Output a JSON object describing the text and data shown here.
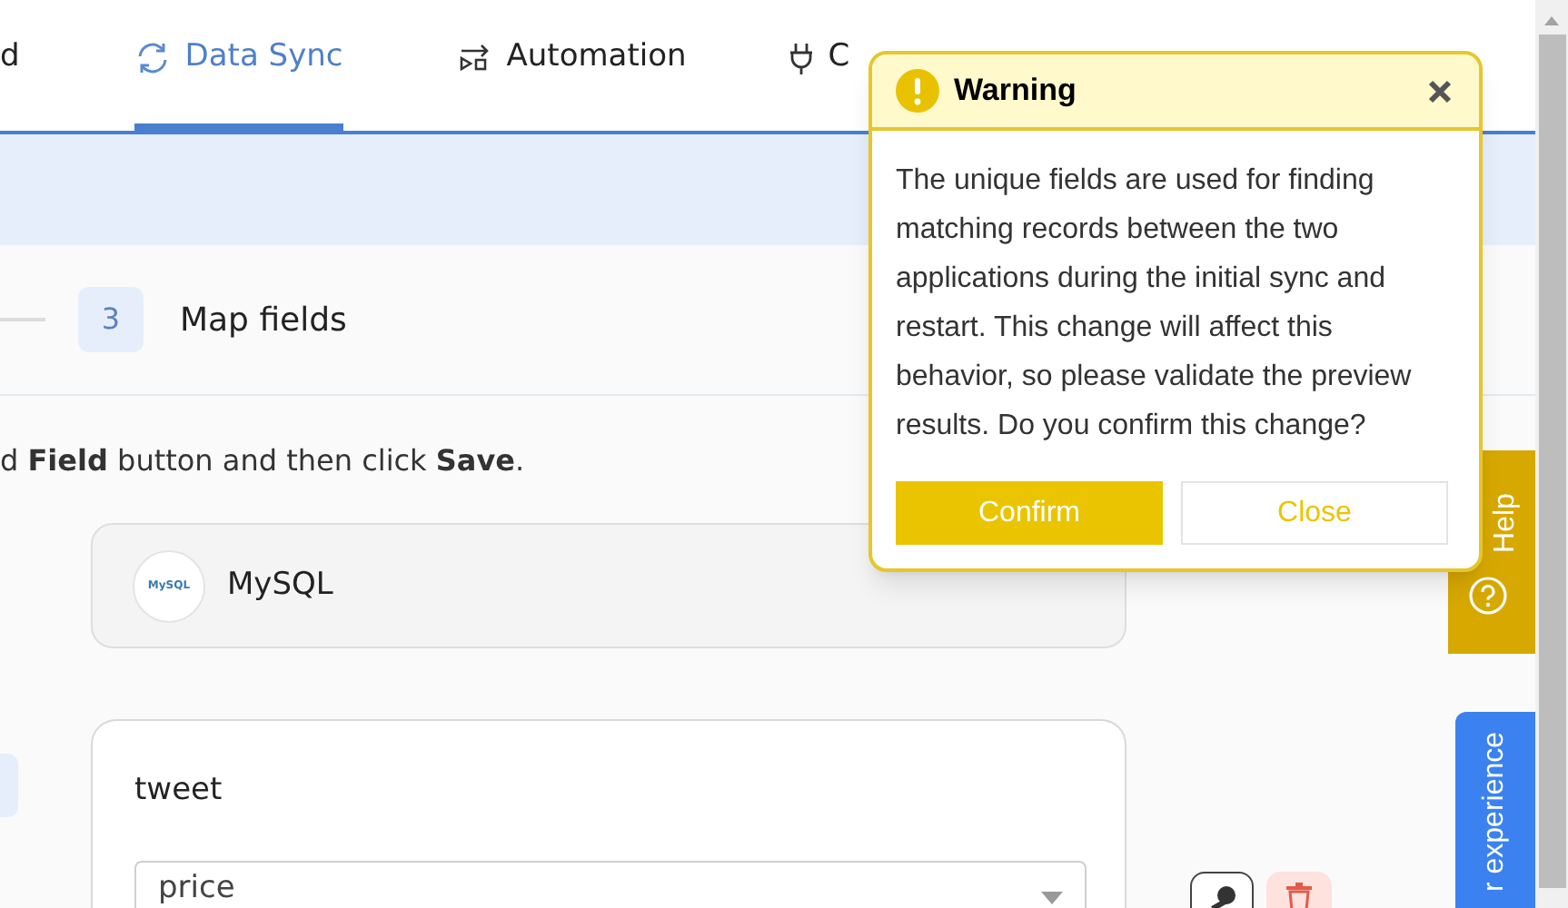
{
  "nav_tabs": [
    {
      "label": "d",
      "selected": false
    },
    {
      "label": "Data Sync",
      "selected": true
    },
    {
      "label": "Automation",
      "selected": false
    },
    {
      "label": "C",
      "selected": false
    }
  ],
  "steps": [
    {
      "number": "3",
      "label": "Map fields"
    }
  ],
  "instruction": "d **Field** button and then click **Save**.",
  "source_card": {
    "logo_text": "MySQL",
    "name": "MySQL"
  },
  "table_card": {
    "title": "tweet",
    "field": {
      "value": "price"
    }
  },
  "side_tabs": [
    {
      "label": "Help"
    },
    {
      "label": "r experience"
    }
  ],
  "dialog": {
    "title": "Warning",
    "message": "The unique fields are used for finding matching records between the two applications during the initial sync and restart. This change will affect this behavior, so please validate the preview results. Do you confirm this change?",
    "buttons": [
      {
        "label": "Confirm",
        "kind": "primary"
      },
      {
        "label": "Close",
        "kind": "secondary"
      }
    ]
  }
}
